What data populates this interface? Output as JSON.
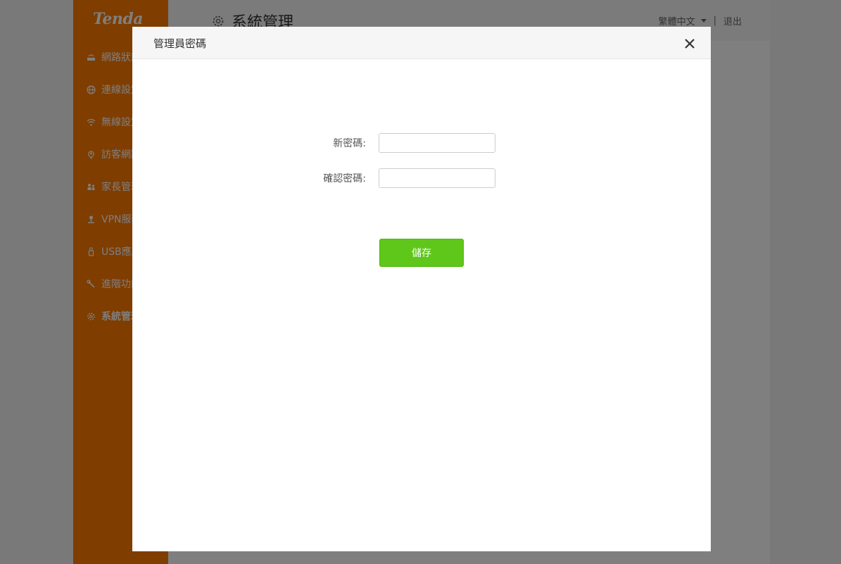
{
  "brand": {
    "logo_text": "Tenda"
  },
  "sidebar": {
    "items": [
      {
        "label": "網路狀態",
        "icon": "router-icon"
      },
      {
        "label": "連線設定",
        "icon": "globe-icon"
      },
      {
        "label": "無線設定",
        "icon": "wifi-icon"
      },
      {
        "label": "訪客網路",
        "icon": "location-icon"
      },
      {
        "label": "家長管理",
        "icon": "family-icon"
      },
      {
        "label": "VPN服務",
        "icon": "vpn-icon"
      },
      {
        "label": "USB應用",
        "icon": "usb-icon"
      },
      {
        "label": "進階功能",
        "icon": "wrench-icon"
      },
      {
        "label": "系統管理",
        "icon": "gear-icon",
        "active": true
      }
    ]
  },
  "header": {
    "title": "系統管理",
    "language": "繁體中文",
    "separator": "|",
    "logout": "退出"
  },
  "modal": {
    "title": "管理員密碼",
    "fields": {
      "new_password": {
        "label": "新密碼:",
        "value": "",
        "placeholder": ""
      },
      "confirm_password": {
        "label": "確認密碼:",
        "value": "",
        "placeholder": ""
      }
    },
    "save_label": "儲存"
  },
  "colors": {
    "sidebar": "#ff7a00",
    "save_button": "#5fc71a",
    "overlay": "rgba(0,0,0,0.5)"
  }
}
